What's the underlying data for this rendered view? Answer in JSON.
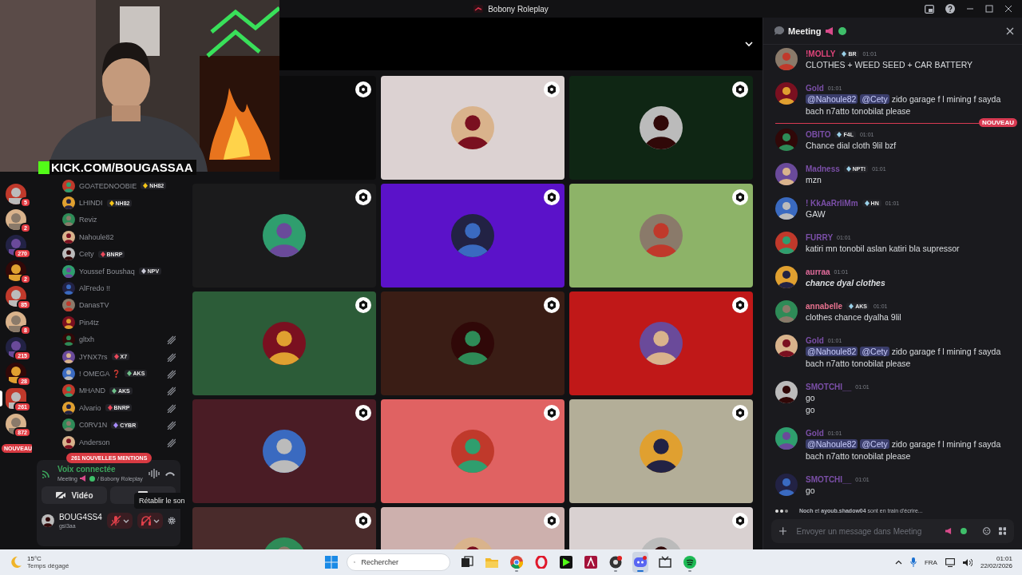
{
  "window": {
    "title": "Bobony Roleplay"
  },
  "stream_overlay": {
    "banner": "KICK.COM/BOUGASSAA"
  },
  "servers": [
    {
      "count": "5",
      "selected": false
    },
    {
      "count": "2",
      "selected": false
    },
    {
      "count": "270",
      "selected": false
    },
    {
      "count": "2",
      "selected": false
    },
    {
      "count": "85",
      "selected": false
    },
    {
      "count": "8",
      "selected": false
    },
    {
      "count": "215",
      "selected": false
    },
    {
      "count": "28",
      "selected": false
    },
    {
      "count": "261",
      "selected": true
    },
    {
      "count": "872",
      "selected": false
    }
  ],
  "servers_new_label": "NOUVEAU",
  "members": [
    {
      "name": "GOATEDNOOBIE",
      "tag": "NH82",
      "color": "#f5c518",
      "deafened": false
    },
    {
      "name": "LHINDI",
      "tag": "NH82",
      "color": "#f5c518",
      "deafened": false
    },
    {
      "name": "Reviz",
      "deafened": false
    },
    {
      "name": "Nahoule82",
      "deafened": false
    },
    {
      "name": "Cety",
      "tag": "BNRP",
      "color": "#e8485a",
      "deafened": false
    },
    {
      "name": "Youssef Boushaq",
      "tag": "NPV",
      "color": "#c9c9d6",
      "deafened": false
    },
    {
      "name": "AlFredo !!",
      "deafened": false
    },
    {
      "name": "DanasTV",
      "deafened": false
    },
    {
      "name": "Pin4tz",
      "deafened": false
    },
    {
      "name": "gltxh",
      "deafened": true
    },
    {
      "name": "JYNX7rs",
      "tag": "X7",
      "color": "#e8485a",
      "deafened": true
    },
    {
      "name": "! OMEGA ❓",
      "tag": "AKS",
      "color": "#6fbf8a",
      "deafened": true
    },
    {
      "name": "MHAND",
      "tag": "AKS",
      "color": "#6fbf8a",
      "deafened": true
    },
    {
      "name": "Alvario",
      "tag": "BNRP",
      "color": "#e8485a",
      "deafened": true
    },
    {
      "name": "C0RV1N",
      "tag": "CYBR",
      "color": "#a78bfa",
      "deafened": true
    },
    {
      "name": "Anderson",
      "deafened": true
    }
  ],
  "mentions_pill": "261 NOUVELLES MENTIONS",
  "voice": {
    "status": "Voix connectée",
    "channel": "Meeting",
    "server": "/ Bobony Roleplay",
    "video_label": "Vidéo",
    "tooltip": "Rétablir le son",
    "user_name": "BOUG4SS4",
    "user_handle": "gsi3aa",
    "mic_muted": true,
    "deafened": true
  },
  "tiles": [
    {
      "color": "#0b0b0c",
      "avatar": false
    },
    {
      "color": "#dcd2d2",
      "avatar": true
    },
    {
      "color": "#0f2614",
      "avatar": true
    },
    {
      "color": "#1b1b1c",
      "avatar": true
    },
    {
      "color": "#5b12c9",
      "avatar": true
    },
    {
      "color": "#8db368",
      "avatar": true
    },
    {
      "color": "#2c5c38",
      "avatar": true
    },
    {
      "color": "#3a1d15",
      "avatar": true
    },
    {
      "color": "#c01818",
      "avatar": true
    },
    {
      "color": "#4a1c25",
      "avatar": true
    },
    {
      "color": "#e06262",
      "avatar": true
    },
    {
      "color": "#b3ae98",
      "avatar": true
    },
    {
      "color": "#4a2b2b",
      "avatar": true
    },
    {
      "color": "#cdb0ad",
      "avatar": true
    },
    {
      "color": "#d9d1d1",
      "avatar": true
    }
  ],
  "chat": {
    "channel": "Meeting",
    "new_label": "NOUVEAU",
    "typing": "**Noch** et **ayoub.shadow04** sont en train d'écrire...",
    "placeholder": "Envoyer un message dans Meeting",
    "messages": [
      {
        "author": "!MOLLY",
        "color": "#e0457b",
        "tag": "BR",
        "time": "01:01",
        "emphasis": false,
        "new_after": false,
        "lines": [
          {
            "text": "CLOTHES + WEED SEED + CAR BATTERY"
          }
        ]
      },
      {
        "author": "Gold",
        "color": "#7b4fa8",
        "time": "01:01",
        "emphasis": false,
        "new_after": true,
        "lines": [
          {
            "mentions": [
              "@Nahoule82",
              "@Cety"
            ],
            "text": "zido garage f l mining f sayda"
          },
          {
            "text": "bach n7atto tonobilat please"
          }
        ]
      },
      {
        "author": "OBITO",
        "color": "#7b4fa8",
        "tag": "F4L",
        "time": "01:01",
        "emphasis": false,
        "new_after": false,
        "lines": [
          {
            "text": "Chance dial cloth 9lil bzf"
          }
        ]
      },
      {
        "author": "Madness",
        "color": "#7b4fa8",
        "tag": "NPT!",
        "time": "01:01",
        "emphasis": false,
        "new_after": false,
        "lines": [
          {
            "text": "mzn"
          }
        ]
      },
      {
        "author": "! KkAaRrIiMm",
        "color": "#7b4fa8",
        "tag": "HN",
        "time": "01:01",
        "emphasis": false,
        "new_after": false,
        "lines": [
          {
            "text": "GAW"
          }
        ]
      },
      {
        "author": "FURRY",
        "color": "#7b4fa8",
        "time": "01:01",
        "emphasis": false,
        "new_after": false,
        "lines": [
          {
            "text": "katiri mn tonobil aslan katiri bla supressor"
          }
        ]
      },
      {
        "author": "aurraa",
        "color": "#e06a9a",
        "time": "01:01",
        "emphasis": true,
        "new_after": false,
        "lines": [
          {
            "text": "chance dyal clothes"
          }
        ]
      },
      {
        "author": "annabelle",
        "color": "#e8728f",
        "tag": "AKS",
        "time": "01:01",
        "emphasis": false,
        "new_after": false,
        "lines": [
          {
            "text": "clothes  chance dyalha 9lil"
          }
        ]
      },
      {
        "author": "Gold",
        "color": "#7b4fa8",
        "time": "01:01",
        "emphasis": false,
        "new_after": false,
        "lines": [
          {
            "mentions": [
              "@Nahoule82",
              "@Cety"
            ],
            "text": "zido garage f l mining f sayda"
          },
          {
            "text": "bach n7atto tonobilat please"
          }
        ]
      },
      {
        "author": "SMOTCHI__",
        "color": "#7b4fa8",
        "time": "01:01",
        "emphasis": false,
        "new_after": false,
        "lines": [
          {
            "text": "go"
          },
          {
            "text": "go"
          }
        ]
      },
      {
        "author": "Gold",
        "color": "#7b4fa8",
        "time": "01:01",
        "emphasis": false,
        "new_after": false,
        "lines": [
          {
            "mentions": [
              "@Nahoule82",
              "@Cety"
            ],
            "text": "zido garage f l mining f sayda"
          },
          {
            "text": "bach n7atto tonobilat please"
          }
        ]
      },
      {
        "author": "SMOTCHI__",
        "color": "#7b4fa8",
        "time": "01:01",
        "emphasis": false,
        "new_after": false,
        "lines": [
          {
            "text": "go"
          }
        ]
      }
    ]
  },
  "taskbar": {
    "temperature": "15°C",
    "weather": "Temps dégagé",
    "search_placeholder": "Rechercher",
    "language": "FRA",
    "time": "01:01",
    "date": "22/02/2026",
    "apps": [
      {
        "kind": "taskview",
        "running": false,
        "selected": false
      },
      {
        "kind": "folder",
        "running": false,
        "selected": false
      },
      {
        "kind": "browser",
        "running": true,
        "selected": false
      },
      {
        "kind": "ring",
        "running": false,
        "selected": false
      },
      {
        "kind": "play",
        "running": false,
        "selected": false
      },
      {
        "kind": "letter",
        "running": false,
        "selected": false
      },
      {
        "kind": "disc",
        "running": true,
        "selected": false
      },
      {
        "kind": "chat",
        "running": true,
        "selected": true
      },
      {
        "kind": "tray",
        "running": false,
        "selected": false
      },
      {
        "kind": "music",
        "running": true,
        "selected": false
      }
    ]
  }
}
